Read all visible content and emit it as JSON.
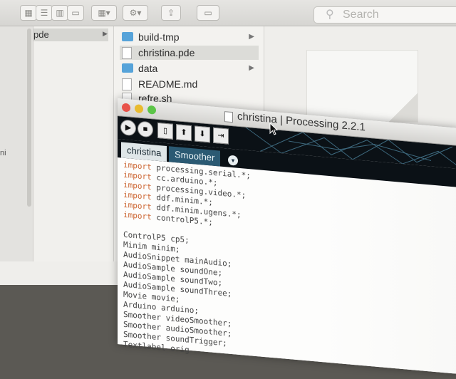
{
  "finder": {
    "search": {
      "placeholder": "Search",
      "icon": "search-icon"
    },
    "toolbar_buttons": [
      "icon-view-icon",
      "list-view-icon",
      "column-view-icon",
      "cover-flow-icon",
      "arrange-icon",
      "action-gear-icon",
      "share-icon",
      "tag-icon"
    ],
    "sidebar": {
      "partial_text": "ni"
    },
    "column1": {
      "selected_item": "pde"
    },
    "column2": {
      "items": [
        {
          "name": "build-tmp",
          "type": "folder",
          "has_children": true
        },
        {
          "name": "christina.pde",
          "type": "file",
          "selected": true
        },
        {
          "name": "data",
          "type": "folder",
          "has_children": true
        },
        {
          "name": "README.md",
          "type": "file"
        },
        {
          "name": "refre.sh",
          "type": "file"
        }
      ]
    }
  },
  "processing": {
    "title": "christina | Processing 2.2.1",
    "toolbar": {
      "buttons": [
        {
          "name": "run-button",
          "glyph": "▶"
        },
        {
          "name": "stop-button",
          "glyph": "■"
        },
        {
          "name": "new-button",
          "glyph": "▯"
        },
        {
          "name": "open-button",
          "glyph": "⬆"
        },
        {
          "name": "save-button",
          "glyph": "⬇"
        },
        {
          "name": "export-button",
          "glyph": "⇥"
        }
      ]
    },
    "tabs": [
      {
        "label": "christina",
        "active": true
      },
      {
        "label": "Smoother",
        "active": false
      }
    ],
    "tab_menu_glyph": "▾",
    "code": [
      {
        "kw": "import",
        "text": " processing.serial.*;"
      },
      {
        "kw": "import",
        "text": " cc.arduino.*;"
      },
      {
        "kw": "import",
        "text": " processing.video.*;"
      },
      {
        "kw": "import",
        "text": " ddf.minim.*;"
      },
      {
        "kw": "import",
        "text": " ddf.minim.ugens.*;"
      },
      {
        "kw": "import",
        "text": " controlP5.*;"
      },
      {
        "kw": "",
        "text": ""
      },
      {
        "kw": "",
        "text": "ControlP5 cp5;"
      },
      {
        "kw": "",
        "text": "Minim minim;"
      },
      {
        "kw": "",
        "text": "AudioSnippet mainAudio;"
      },
      {
        "kw": "",
        "text": "AudioSample soundOne;"
      },
      {
        "kw": "",
        "text": "AudioSample soundTwo;"
      },
      {
        "kw": "",
        "text": "AudioSample soundThree;"
      },
      {
        "kw": "",
        "text": "Movie movie;"
      },
      {
        "kw": "",
        "text": "Arduino arduino;"
      },
      {
        "kw": "",
        "text": "Smoother videoSmoother;"
      },
      {
        "kw": "",
        "text": "Smoother audioSmoother;"
      },
      {
        "kw": "",
        "text": "Smoother soundTrigger;"
      },
      {
        "kw": "",
        "text": "Textlabel orig"
      }
    ]
  },
  "colors": {
    "keyword": "#cc6633",
    "tab_active_bg": "#dfe6e8",
    "tab_inactive_bg": "#2b5a73",
    "toolbar_bg": "#0b1116",
    "folder": "#56a3d9"
  }
}
